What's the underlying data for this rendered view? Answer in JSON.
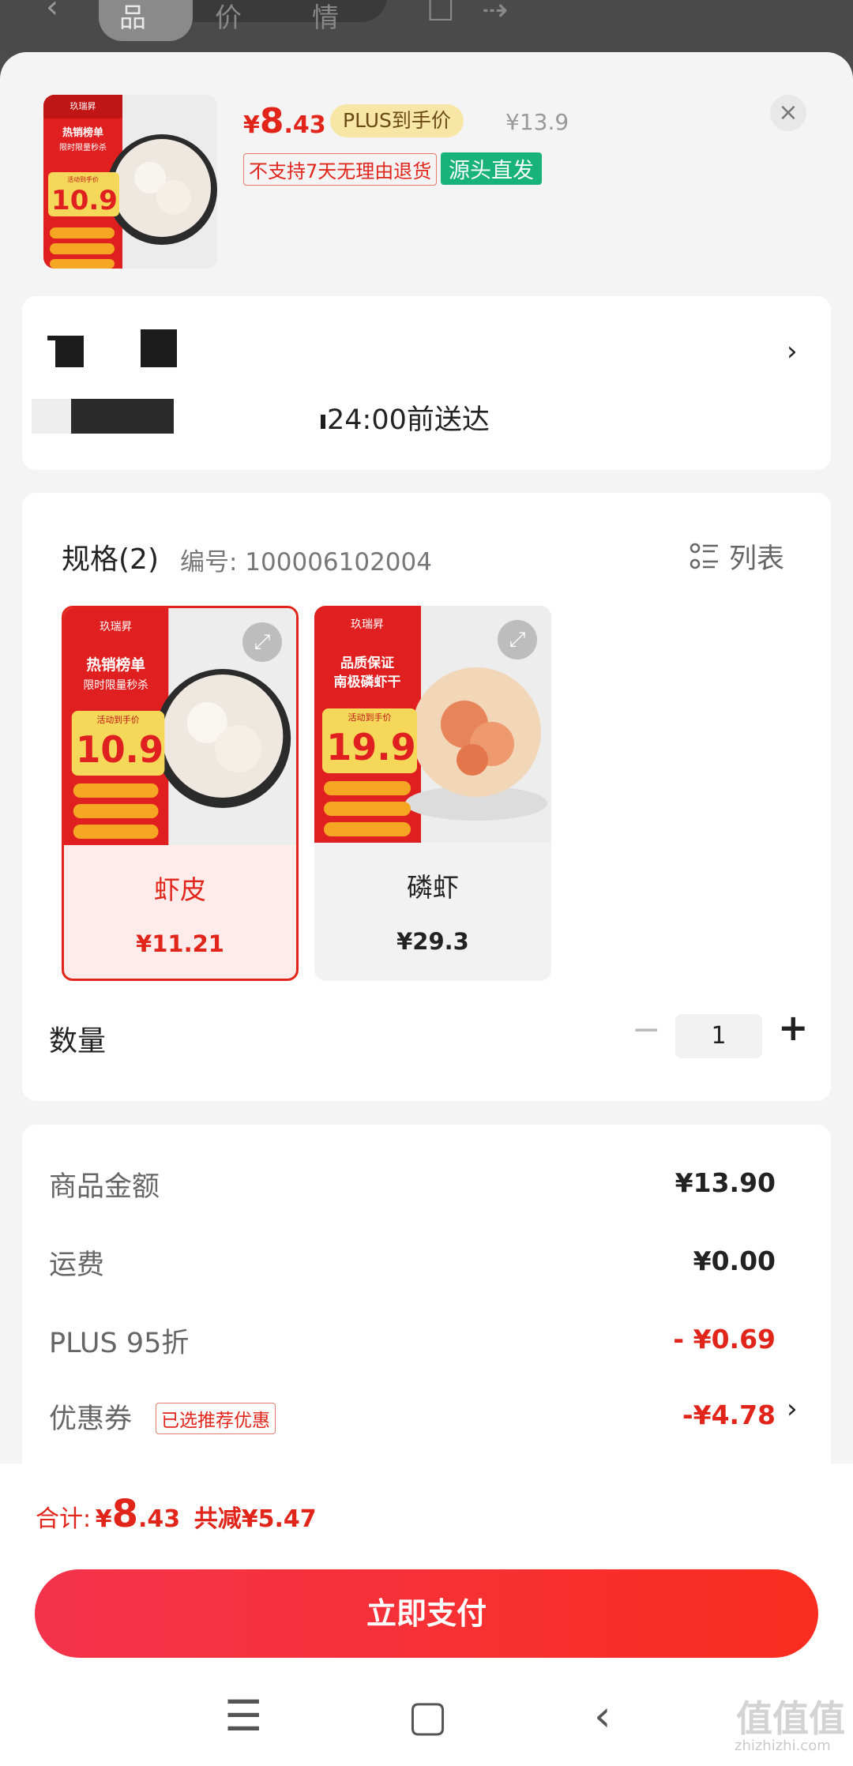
{
  "top_bar": {
    "tabs": [
      "商品",
      "评价",
      "详情"
    ]
  },
  "header": {
    "price_currency": "¥",
    "price_int": "8",
    "price_dec": ".43",
    "plus_badge": "PLUS到手价",
    "original_price": "¥13.9",
    "close_icon": "×",
    "no_return_tag": "不支持7天无理由退货",
    "source_tag": "源头直发"
  },
  "thumbnail": {
    "brand": "玖瑞昇",
    "headline1": "热销榜单",
    "headline2": "限时限量秒杀",
    "promo_label": "活动到手价",
    "promo_price": "10.9"
  },
  "address": {
    "delivery_text": "24:00前送达"
  },
  "spec": {
    "title": "规格(2)",
    "code_label": "编号: 100006102004",
    "list_toggle": "列表",
    "options": [
      {
        "name": "虾皮",
        "price": "¥11.21",
        "promo_price": "10.9",
        "headline1": "热销榜单",
        "headline2": "限时限量秒杀",
        "selected": true
      },
      {
        "name": "磷虾",
        "price": "¥29.3",
        "promo_price": "19.9",
        "headline1": "品质保证",
        "headline2": "南极磷虾干",
        "selected": false
      }
    ]
  },
  "quantity": {
    "label": "数量",
    "value": "1"
  },
  "summary": {
    "goods_label": "商品金额",
    "goods_value": "¥13.90",
    "shipping_label": "运费",
    "shipping_value": "¥0.00",
    "plus_label": "PLUS 95折",
    "plus_value": "- ¥0.69",
    "coupon_label": "优惠券",
    "coupon_tag": "已选推荐优惠",
    "coupon_value": "-¥4.78"
  },
  "total": {
    "label": "合计:",
    "currency": "¥",
    "price_int": "8",
    "price_dec": ".43",
    "saved": "共减¥5.47"
  },
  "pay_button": "立即支付",
  "watermark": {
    "logo": "值值值",
    "site": "zhizhizhi.com"
  },
  "colors": {
    "accent": "#e1251b",
    "green_tag": "#17b37b",
    "plus_badge_bg": "#f7e6a6"
  }
}
